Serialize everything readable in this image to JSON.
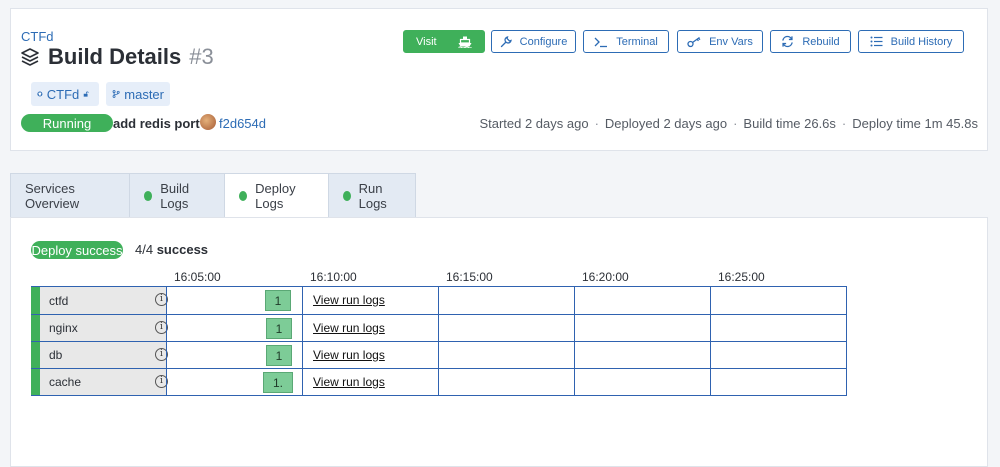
{
  "header": {
    "project": "CTFd",
    "title": "Build Details",
    "build_number": "#3",
    "repo_chip": "CTFd",
    "branch_chip": "master",
    "status": "Running",
    "commit_message": "add redis port",
    "commit_sha": "f2d654d",
    "meta": {
      "started": "Started 2 days ago",
      "deployed": "Deployed 2 days ago",
      "build_time": "Build time 26.6s",
      "deploy_time": "Deploy time 1m 45.8s",
      "separator": "·"
    }
  },
  "actions": {
    "visit": "Visit",
    "configure": "Configure",
    "terminal": "Terminal",
    "env_vars": "Env Vars",
    "rebuild": "Rebuild",
    "build_history": "Build History"
  },
  "tabs": [
    {
      "label": "Services Overview"
    },
    {
      "label": "Build Logs"
    },
    {
      "label": "Deploy Logs"
    },
    {
      "label": "Run Logs"
    }
  ],
  "deploy": {
    "status": "Deploy success",
    "count": "4/4",
    "count_suffix": "success",
    "ticks": [
      "16:05:00",
      "16:10:00",
      "16:15:00",
      "16:20:00",
      "16:25:00"
    ],
    "services": [
      {
        "name": "ctfd",
        "bar_label": "1",
        "link": "View run logs"
      },
      {
        "name": "nginx",
        "bar_label": "1",
        "link": "View run logs"
      },
      {
        "name": "db",
        "bar_label": "1",
        "link": "View run logs"
      },
      {
        "name": "cache",
        "bar_label": "1.",
        "link": "View run logs"
      }
    ]
  },
  "colors": {
    "accent": "#2d6cb5",
    "success": "#3fb05a",
    "bar": "#7dcc97"
  }
}
